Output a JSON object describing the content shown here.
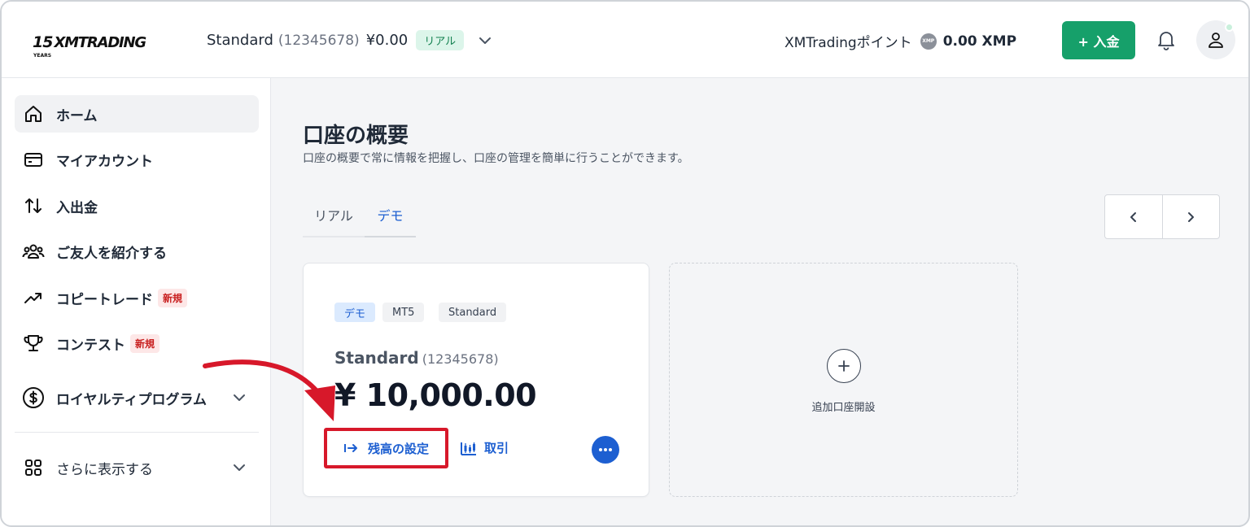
{
  "header": {
    "logo_number": "15",
    "logo_years": "YEARS",
    "logo_text": "XMTRADING",
    "account_type": "Standard",
    "account_number": "(12345678)",
    "account_balance": "¥0.00",
    "account_badge": "リアル",
    "points_label": "XMTradingポイント",
    "points_coin": "XMP",
    "points_amount": "0.00 XMP",
    "deposit_label": "+ 入金"
  },
  "sidebar": {
    "items": [
      {
        "label": "ホーム",
        "icon": "home-icon"
      },
      {
        "label": "マイアカウント",
        "icon": "card-icon"
      },
      {
        "label": "入出金",
        "icon": "transfer-icon"
      },
      {
        "label": "ご友人を紹介する",
        "icon": "people-icon"
      },
      {
        "label": "コピートレード",
        "icon": "trend-icon",
        "badge": "新規"
      },
      {
        "label": "コンテスト",
        "icon": "trophy-icon",
        "badge": "新規"
      },
      {
        "label": "ロイヤルティプログラム",
        "icon": "dollar-icon"
      },
      {
        "label": "さらに表示する",
        "icon": "grid-icon"
      }
    ]
  },
  "main": {
    "title": "口座の概要",
    "subtitle": "口座の概要で常に情報を把握し、口座の管理を簡単に行うことができます。",
    "tabs": [
      {
        "label": "リアル"
      },
      {
        "label": "デモ"
      }
    ],
    "card": {
      "tags": [
        "デモ",
        "MT5",
        "Standard"
      ],
      "name": "Standard",
      "number": "(12345678)",
      "balance": "¥ 10,000.00",
      "set_balance_label": "残高の設定",
      "trade_label": "取引"
    },
    "add_card": {
      "label": "追加口座開設"
    }
  },
  "colors": {
    "accent_blue": "#1d5fd1",
    "deposit_green": "#16a06a",
    "highlight_red": "#d7182a"
  }
}
